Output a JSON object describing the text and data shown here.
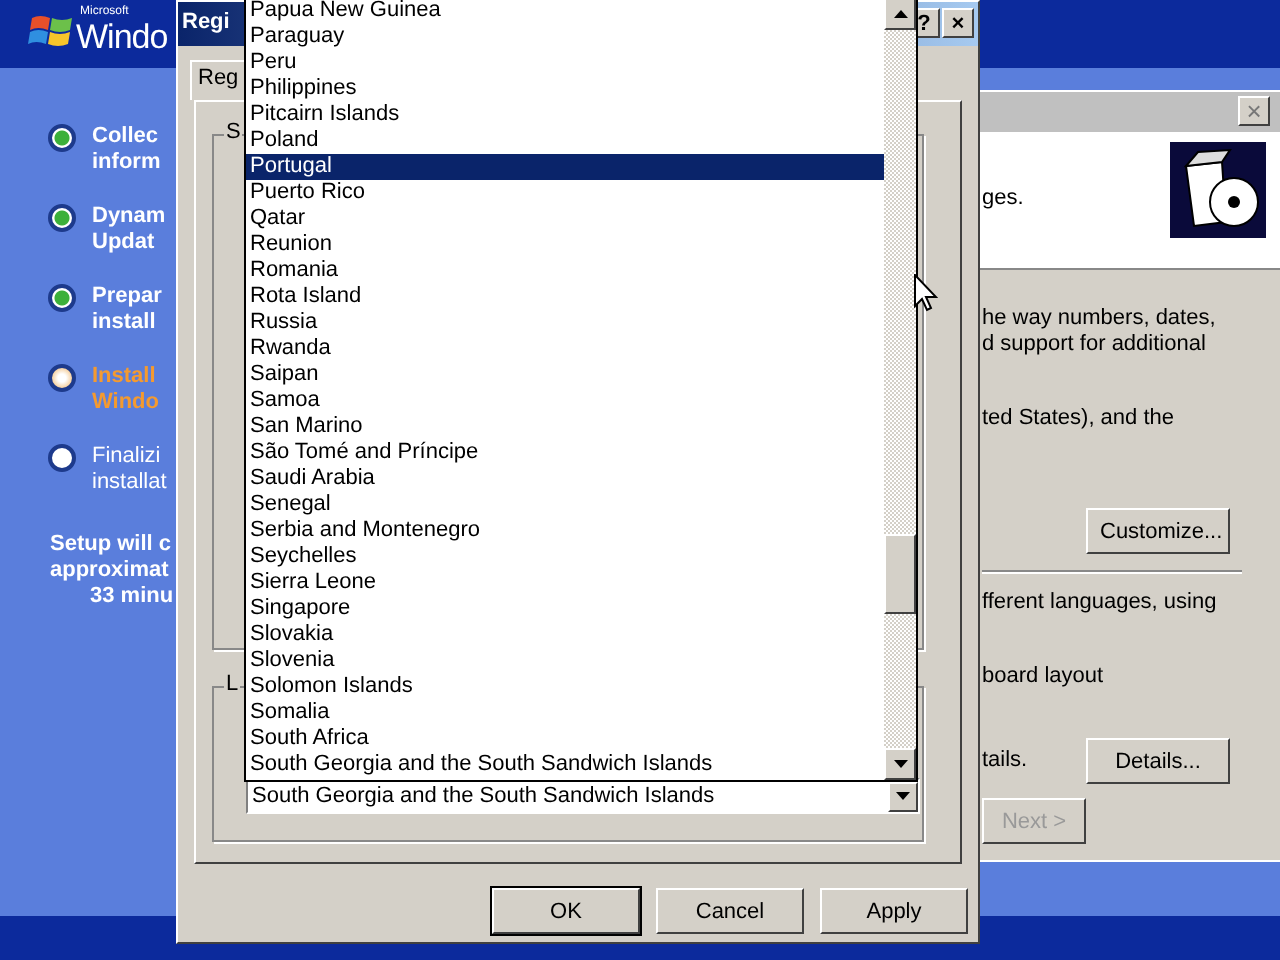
{
  "setup": {
    "logo_text": "Windo",
    "logo_small": "Microsoft",
    "steps": [
      {
        "lines": [
          "Collec",
          "inform"
        ],
        "kind": "done"
      },
      {
        "lines": [
          "Dynam",
          "Updat"
        ],
        "kind": "done"
      },
      {
        "lines": [
          "Prepar",
          "install"
        ],
        "kind": "done"
      },
      {
        "lines": [
          "Install",
          "Windo"
        ],
        "kind": "current"
      },
      {
        "lines": [
          "Finalizi",
          "installat"
        ],
        "kind": "pending"
      }
    ],
    "estimate": [
      "Setup will c",
      "approximat",
      "33 minu"
    ]
  },
  "wizard": {
    "header_text": "ges.",
    "body": [
      {
        "kind": "text",
        "text": "he way numbers, dates,"
      },
      {
        "kind": "text",
        "text": "d support for additional"
      },
      {
        "kind": "text",
        "text": "ted States), and the"
      },
      {
        "kind": "button",
        "text": "Customize..."
      },
      {
        "kind": "divider"
      },
      {
        "kind": "text",
        "text": "fferent languages, using"
      },
      {
        "kind": "text",
        "text": "board layout"
      },
      {
        "kind": "text",
        "text": "tails.",
        "button": "Details..."
      }
    ],
    "next_button": {
      "label": "Next >",
      "disabled": true
    }
  },
  "dialog": {
    "title": "Regi",
    "help": "?",
    "close": "×",
    "tab": "Reg",
    "group1": "S",
    "group2": "L",
    "combo_value": "South Georgia and the South Sandwich Islands",
    "buttons": [
      {
        "label": "OK",
        "default": true
      },
      {
        "label": "Cancel",
        "default": false
      },
      {
        "label": "Apply",
        "default": false
      }
    ]
  },
  "dropdown": {
    "items": [
      {
        "label": "Papua New Guinea",
        "selected": false
      },
      {
        "label": "Paraguay",
        "selected": false
      },
      {
        "label": "Peru",
        "selected": false
      },
      {
        "label": "Philippines",
        "selected": false
      },
      {
        "label": "Pitcairn Islands",
        "selected": false
      },
      {
        "label": "Poland",
        "selected": false
      },
      {
        "label": "Portugal",
        "selected": true
      },
      {
        "label": "Puerto Rico",
        "selected": false
      },
      {
        "label": "Qatar",
        "selected": false
      },
      {
        "label": "Reunion",
        "selected": false
      },
      {
        "label": "Romania",
        "selected": false
      },
      {
        "label": "Rota Island",
        "selected": false
      },
      {
        "label": "Russia",
        "selected": false
      },
      {
        "label": "Rwanda",
        "selected": false
      },
      {
        "label": "Saipan",
        "selected": false
      },
      {
        "label": "Samoa",
        "selected": false
      },
      {
        "label": "San Marino",
        "selected": false
      },
      {
        "label": "São Tomé and Príncipe",
        "selected": false
      },
      {
        "label": "Saudi Arabia",
        "selected": false
      },
      {
        "label": "Senegal",
        "selected": false
      },
      {
        "label": "Serbia and Montenegro",
        "selected": false
      },
      {
        "label": "Seychelles",
        "selected": false
      },
      {
        "label": "Sierra Leone",
        "selected": false
      },
      {
        "label": "Singapore",
        "selected": false
      },
      {
        "label": "Slovakia",
        "selected": false
      },
      {
        "label": "Slovenia",
        "selected": false
      },
      {
        "label": "Solomon Islands",
        "selected": false
      },
      {
        "label": "Somalia",
        "selected": false
      },
      {
        "label": "South Africa",
        "selected": false
      },
      {
        "label": "South Georgia and the South Sandwich Islands",
        "selected": false
      }
    ]
  }
}
